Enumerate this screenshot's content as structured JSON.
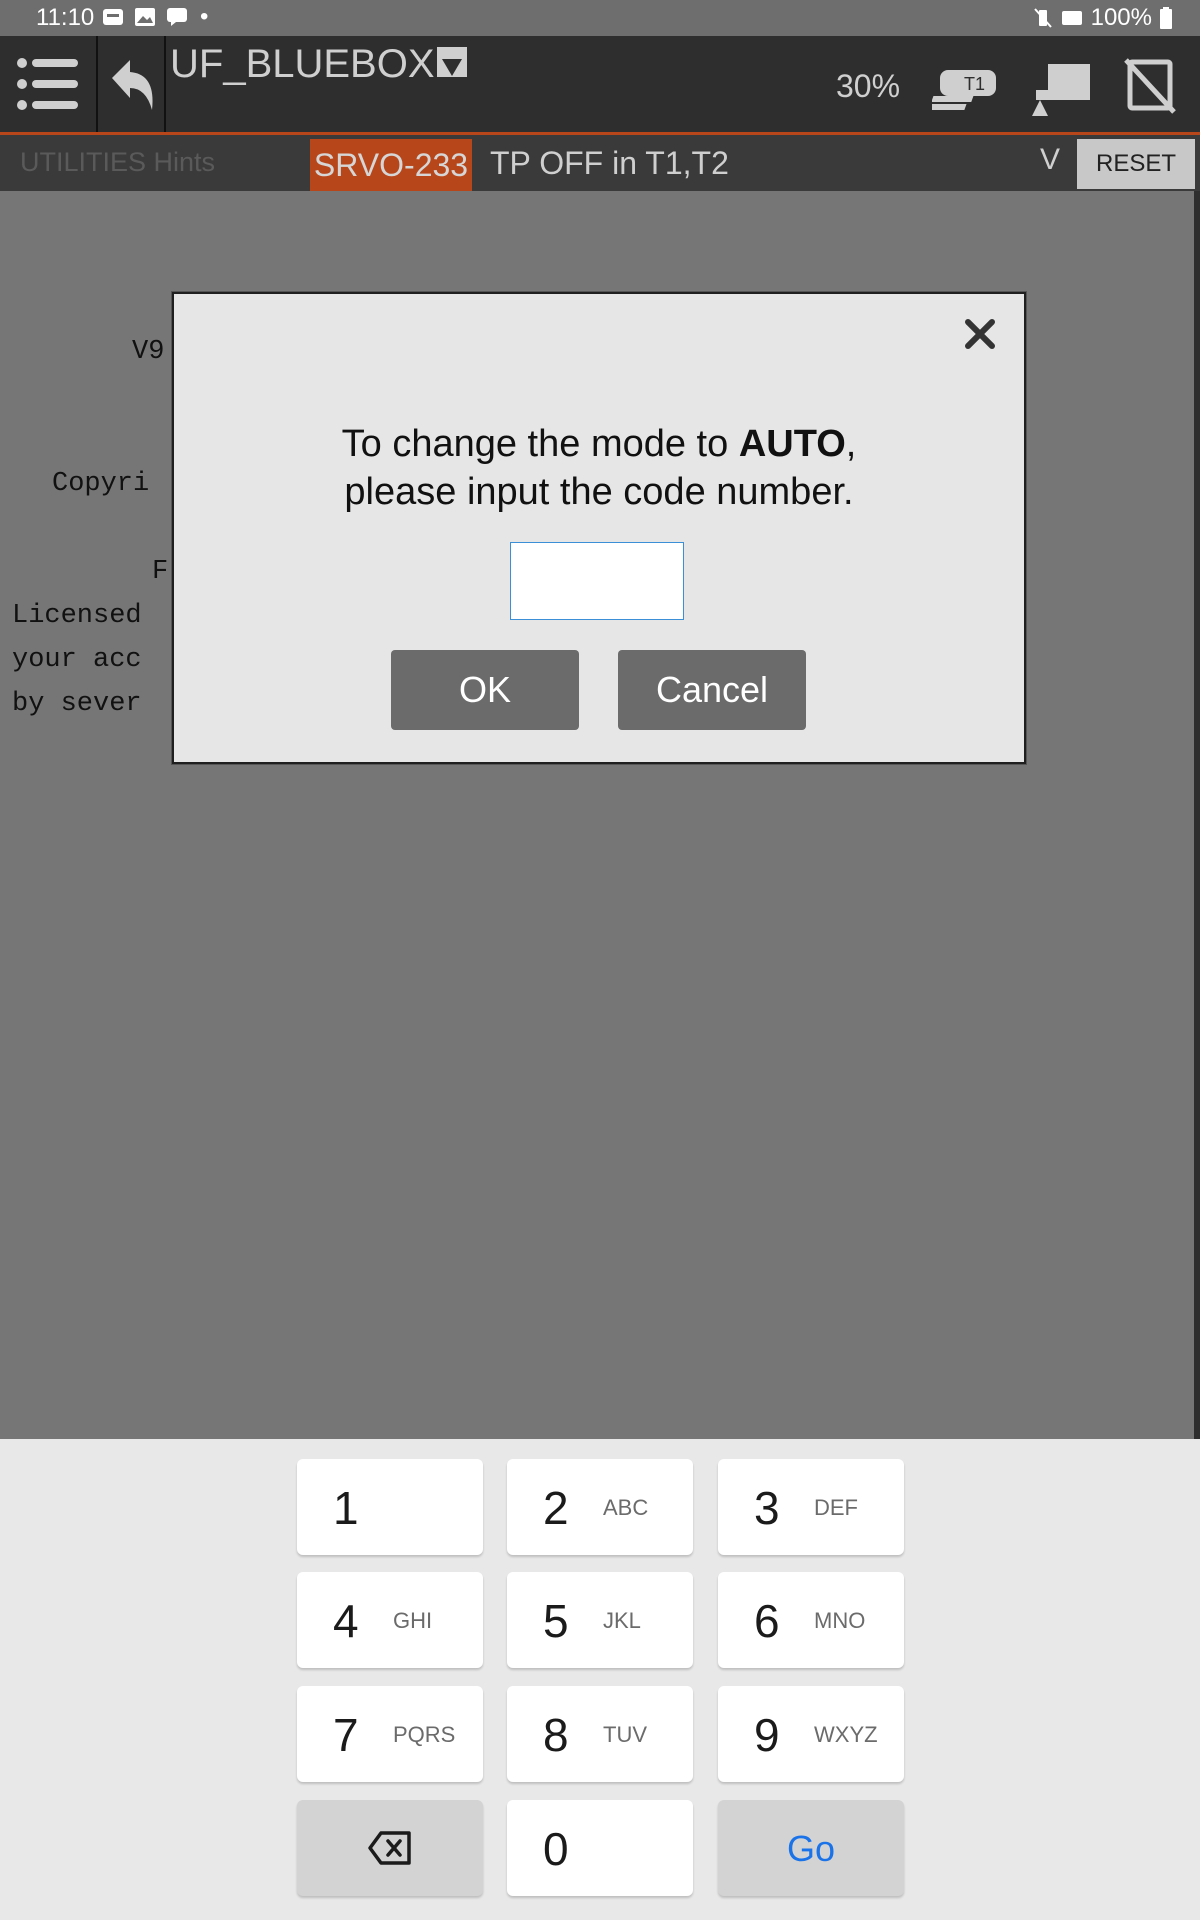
{
  "status_bar": {
    "time": "11:10",
    "battery": "100%"
  },
  "header": {
    "title": "UF_BLUEBOX",
    "override": "30%",
    "t1_label": "T1"
  },
  "alarm_bar": {
    "hints": "UTILITIES Hints",
    "code": "SRVO-233",
    "message": "TP OFF in T1,T2",
    "toggle": "V",
    "reset": "RESET"
  },
  "background_text": {
    "line1": "V9",
    "line2": "Copyri",
    "line3": "F",
    "line4": "Licensed",
    "line5": "your acc",
    "line6": "by sever"
  },
  "dialog": {
    "prompt_before": "To change the mode to ",
    "prompt_bold": "AUTO",
    "prompt_after": ",",
    "prompt_line2": "please input the code number.",
    "input_value": "",
    "ok": "OK",
    "cancel": "Cancel"
  },
  "keyboard": {
    "keys": [
      {
        "num": "1",
        "letters": ""
      },
      {
        "num": "2",
        "letters": "ABC"
      },
      {
        "num": "3",
        "letters": "DEF"
      },
      {
        "num": "4",
        "letters": "GHI"
      },
      {
        "num": "5",
        "letters": "JKL"
      },
      {
        "num": "6",
        "letters": "MNO"
      },
      {
        "num": "7",
        "letters": "PQRS"
      },
      {
        "num": "8",
        "letters": "TUV"
      },
      {
        "num": "9",
        "letters": "WXYZ"
      }
    ],
    "zero": "0",
    "go": "Go"
  },
  "colors": {
    "accent": "#b8461b",
    "link_blue": "#1a73e8",
    "input_border": "#3b8fd6"
  }
}
